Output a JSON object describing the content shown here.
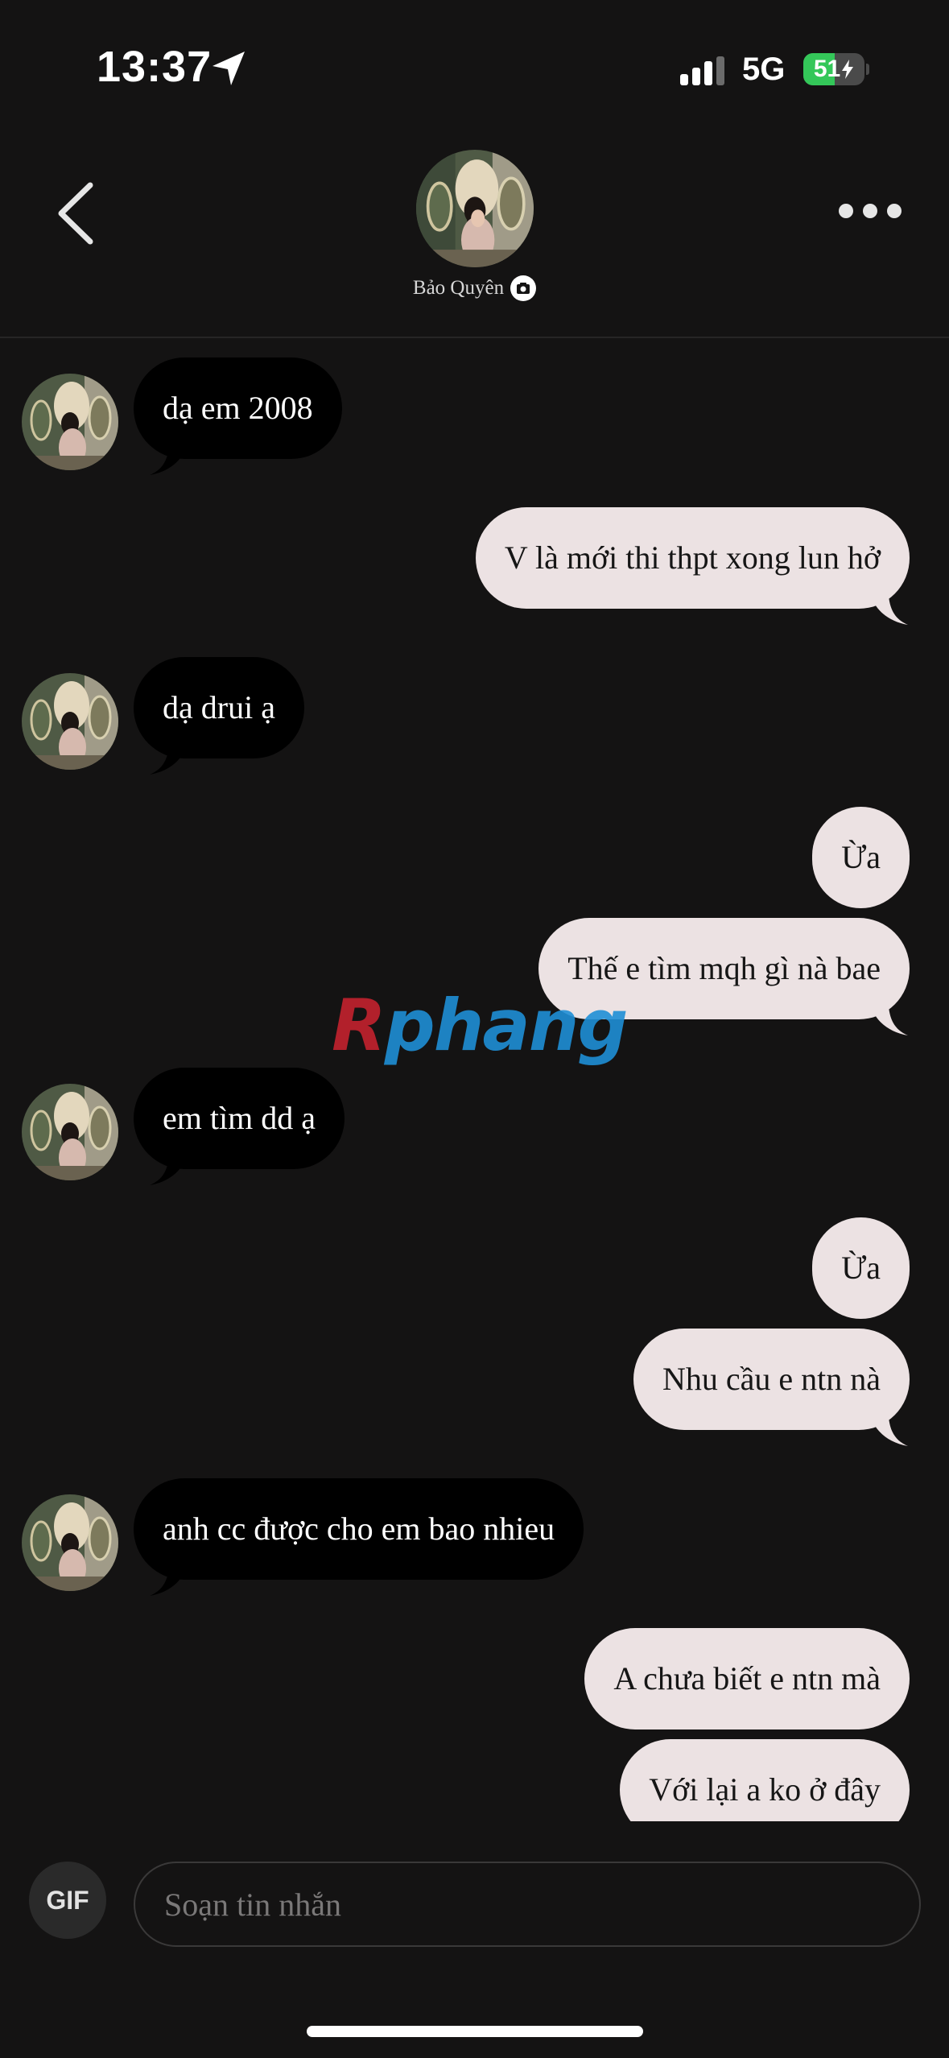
{
  "status_bar": {
    "time": "13:37",
    "network": "5G",
    "battery_percent": "51",
    "battery_level": 0.51,
    "battery_color": "#34c759",
    "icons": [
      "location-arrow-icon",
      "signal-icon",
      "battery-charging-icon"
    ]
  },
  "header": {
    "contact_name": "Bảo Quyên",
    "icons": [
      "back-chevron-icon",
      "more-dots-icon",
      "camera-icon"
    ]
  },
  "messages": [
    {
      "side": "in",
      "text": "dạ em 2008"
    },
    {
      "side": "out",
      "text": "V là mới thi thpt xong lun hở"
    },
    {
      "side": "in",
      "text": "dạ drui ạ"
    },
    {
      "side": "out",
      "text": "Ừa"
    },
    {
      "side": "out",
      "text": "Thế e tìm mqh gì nà bae"
    },
    {
      "side": "in",
      "text": "em tìm dd ạ"
    },
    {
      "side": "out",
      "text": "Ừa"
    },
    {
      "side": "out",
      "text": "Nhu cầu e ntn nà"
    },
    {
      "side": "in",
      "text": "anh cc được cho em bao nhieu"
    },
    {
      "side": "out",
      "text": "A chưa biết e ntn mà"
    },
    {
      "side": "out",
      "text": "Với lại a ko ở đây"
    }
  ],
  "watermark": {
    "first": "R",
    "rest": "phang"
  },
  "composer": {
    "gif_label": "GIF",
    "placeholder": "Soạn tin nhắn"
  },
  "colors": {
    "background": "#141313",
    "incoming_bubble": "#000000",
    "outgoing_bubble": "#ece2e3"
  }
}
